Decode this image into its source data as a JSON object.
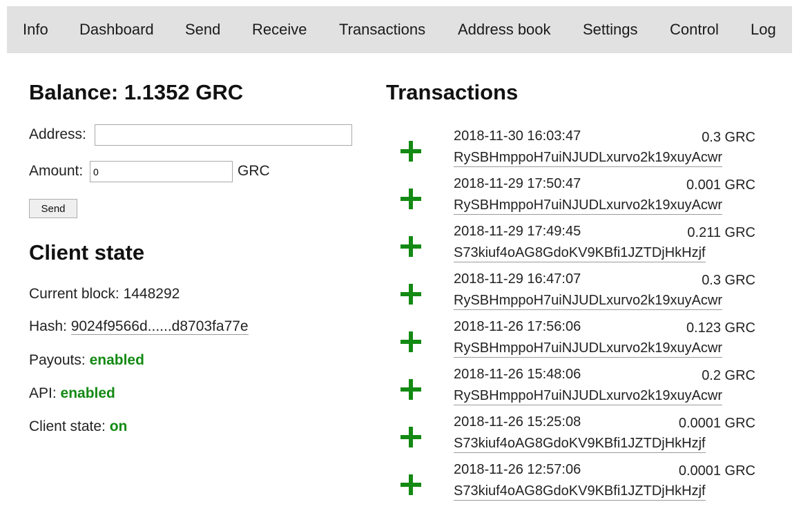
{
  "nav": {
    "items": [
      "Info",
      "Dashboard",
      "Send",
      "Receive",
      "Transactions",
      "Address book",
      "Settings",
      "Control",
      "Log"
    ]
  },
  "send": {
    "balance_title": "Balance: 1.1352 GRC",
    "address_label": "Address:",
    "address_value": "",
    "amount_label": "Amount:",
    "amount_value": "0",
    "unit": "GRC",
    "send_button": "Send"
  },
  "client": {
    "title": "Client state",
    "current_block_label": "Current block:",
    "current_block": "1448292",
    "hash_label": "Hash:",
    "hash": "9024f9566d......d8703fa77e",
    "payouts_label": "Payouts:",
    "payouts": "enabled",
    "api_label": "API:",
    "api": "enabled",
    "state_label": "Client state:",
    "state": "on"
  },
  "transactions": {
    "title": "Transactions",
    "icon": "plus-icon",
    "items": [
      {
        "date": "2018-11-30 16:03:47",
        "amount": "0.3 GRC",
        "address": "RySBHmppoH7uiNJUDLxurvo2k19xuyAcwr"
      },
      {
        "date": "2018-11-29 17:50:47",
        "amount": "0.001 GRC",
        "address": "RySBHmppoH7uiNJUDLxurvo2k19xuyAcwr"
      },
      {
        "date": "2018-11-29 17:49:45",
        "amount": "0.211 GRC",
        "address": "S73kiuf4oAG8GdoKV9KBfi1JZTDjHkHzjf"
      },
      {
        "date": "2018-11-29 16:47:07",
        "amount": "0.3 GRC",
        "address": "RySBHmppoH7uiNJUDLxurvo2k19xuyAcwr"
      },
      {
        "date": "2018-11-26 17:56:06",
        "amount": "0.123 GRC",
        "address": "RySBHmppoH7uiNJUDLxurvo2k19xuyAcwr"
      },
      {
        "date": "2018-11-26 15:48:06",
        "amount": "0.2 GRC",
        "address": "RySBHmppoH7uiNJUDLxurvo2k19xuyAcwr"
      },
      {
        "date": "2018-11-26 15:25:08",
        "amount": "0.0001 GRC",
        "address": "S73kiuf4oAG8GdoKV9KBfi1JZTDjHkHzjf"
      },
      {
        "date": "2018-11-26 12:57:06",
        "amount": "0.0001 GRC",
        "address": "S73kiuf4oAG8GdoKV9KBfi1JZTDjHkHzjf"
      }
    ]
  },
  "colors": {
    "nav_background": "#e1e1e1",
    "enabled_green": "#138a13"
  }
}
